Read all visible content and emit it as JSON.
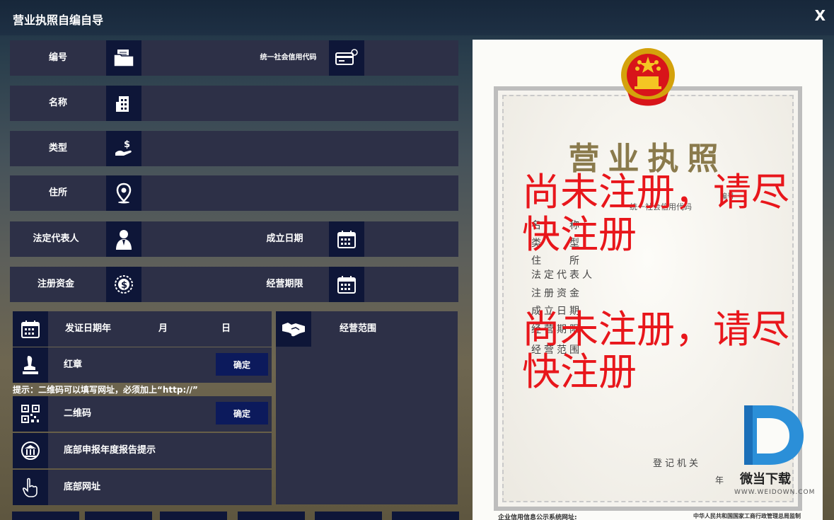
{
  "window": {
    "title": "营业执照自编自导",
    "close": "X"
  },
  "fields": {
    "number": "编号",
    "credit_code": "统一社会信用代码",
    "name": "名称",
    "type": "类型",
    "address": "住所",
    "legal_rep": "法定代表人",
    "founded": "成立日期",
    "capital": "注册资金",
    "term": "经营期限"
  },
  "issue": {
    "label": "发证日期年",
    "month": "月",
    "day": "日"
  },
  "scope_label": "经营范围",
  "stamp": {
    "label": "红章",
    "confirm": "确定"
  },
  "hint": "提示：二维码可以填写网址，必须加上“http://”",
  "qr": {
    "label": "二维码",
    "confirm": "确定"
  },
  "annual_report": "底部申报年度报告提示",
  "footer_url": "底部网址",
  "preview": {
    "title": "营业执照",
    "number_label": "编号",
    "credit_label": "统一社会信用代码",
    "lines": [
      "名　　称",
      "类　　型",
      "住　　所",
      "法定代表人",
      "注册资金",
      "成立日期",
      "经营期限",
      "经营范围"
    ],
    "warning_1": "尚未注册，请尽快注册",
    "warning_2": "尚未注册，请尽快注册",
    "registrar": "登记机关",
    "year": "年",
    "footer_left": "企业信用信息公示系统网址:",
    "footer_right": "中华人民共和国国家工商行政管理总局监制",
    "watermark": "微当下载",
    "watermark_url": "WWW.WEIDOWN.COM"
  },
  "colors": {
    "row_bg": "#2d3047",
    "icon_bg": "#0e1638",
    "warning": "#e8161b"
  }
}
